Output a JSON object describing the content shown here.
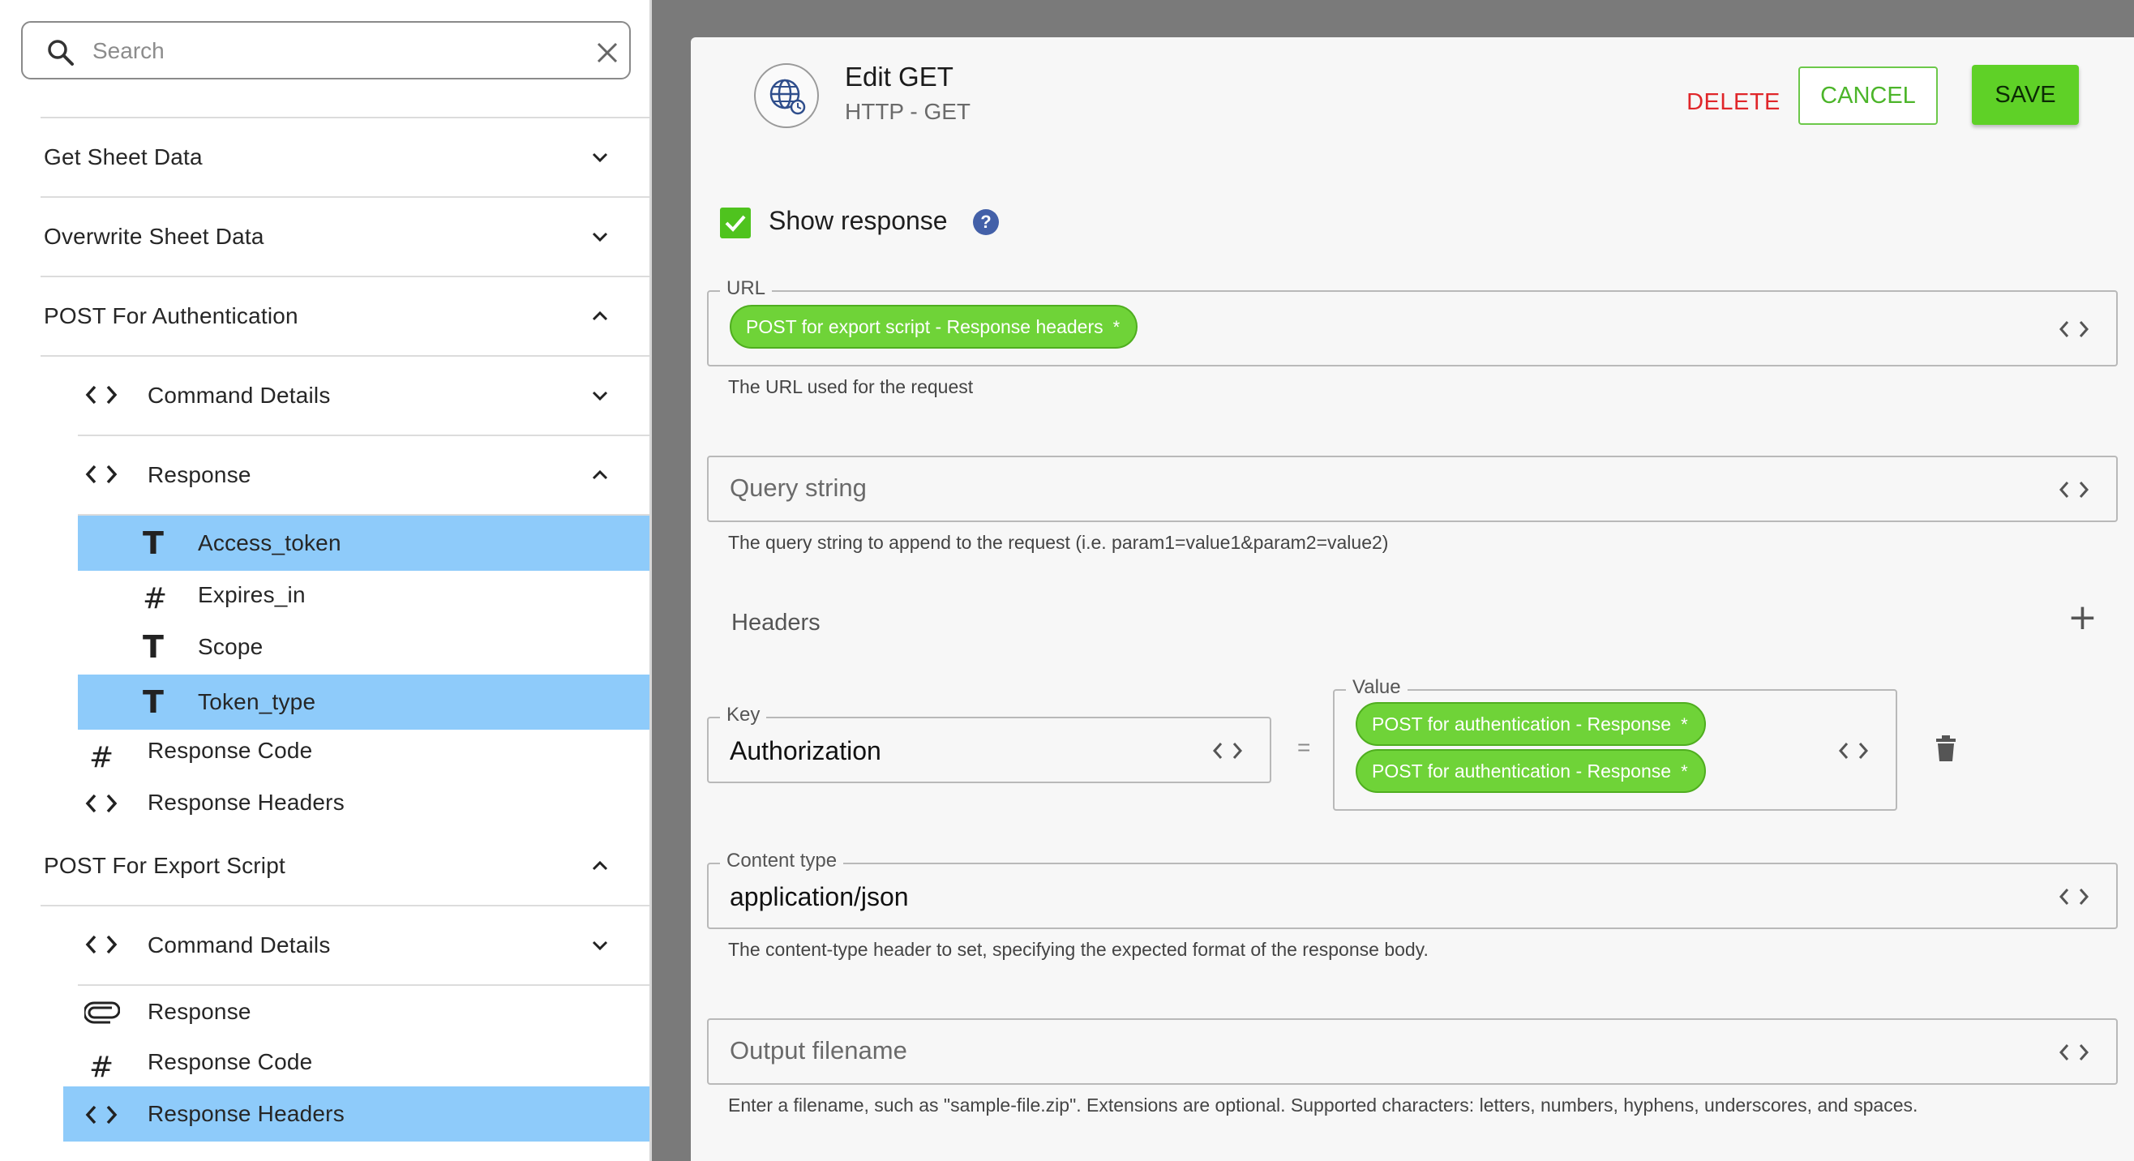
{
  "sidebar": {
    "search": {
      "placeholder": "Search",
      "value": ""
    },
    "sections": [
      {
        "label": "Get Sheet Data",
        "expanded": false
      },
      {
        "label": "Overwrite Sheet Data",
        "expanded": false
      },
      {
        "label": "POST For Authentication",
        "expanded": true,
        "children": [
          {
            "label": "Command Details",
            "icon": "code-icon",
            "expanded": false
          },
          {
            "label": "Response",
            "icon": "code-icon",
            "expanded": true,
            "children": [
              {
                "label": "Access_token",
                "icon": "text-type-icon",
                "selected": true
              },
              {
                "label": "Expires_in",
                "icon": "number-type-icon",
                "selected": false
              },
              {
                "label": "Scope",
                "icon": "text-type-icon",
                "selected": false
              },
              {
                "label": "Token_type",
                "icon": "text-type-icon",
                "selected": true
              }
            ]
          },
          {
            "label": "Response Code",
            "icon": "number-type-icon"
          },
          {
            "label": "Response Headers",
            "icon": "code-icon"
          }
        ]
      },
      {
        "label": "POST For Export Script",
        "expanded": true,
        "children": [
          {
            "label": "Command Details",
            "icon": "code-icon",
            "expanded": false
          },
          {
            "label": "Response",
            "icon": "attachment-icon"
          },
          {
            "label": "Response Code",
            "icon": "number-type-icon"
          },
          {
            "label": "Response Headers",
            "icon": "code-icon",
            "selected": true
          }
        ]
      }
    ]
  },
  "editor": {
    "title": "Edit GET",
    "subtitle": "HTTP - GET",
    "icon": "globe-icon",
    "buttons": {
      "delete": "DELETE",
      "cancel": "CANCEL",
      "save": "SAVE"
    },
    "show_response": {
      "label": "Show response",
      "checked": true,
      "help": "?"
    },
    "url": {
      "label": "URL",
      "chip": "POST for export script - Response headers",
      "helper": "The URL used for the request"
    },
    "query_string": {
      "placeholder": "Query string",
      "helper": "The query string to append to the request (i.e. param1=value1&param2=value2)"
    },
    "headers": {
      "label": "Headers",
      "add": "+",
      "key_label": "Key",
      "key_value": "Authorization",
      "equals": "=",
      "value_label": "Value",
      "value_chips": [
        "POST for authentication - Response",
        "POST for authentication - Response"
      ]
    },
    "content_type": {
      "label": "Content type",
      "value": "application/json",
      "helper": "The content-type header to set, specifying the expected format of the response body."
    },
    "output_filename": {
      "placeholder": "Output filename",
      "helper": "Enter a filename, such as \"sample-file.zip\". Extensions are optional. Supported characters: letters, numbers, hyphens, underscores, and spaces."
    },
    "chip_asterisk": "*",
    "colors": {
      "accent_green": "#5fd127",
      "delete_red": "#e0262a",
      "selection_blue": "#8ecbfa"
    }
  }
}
